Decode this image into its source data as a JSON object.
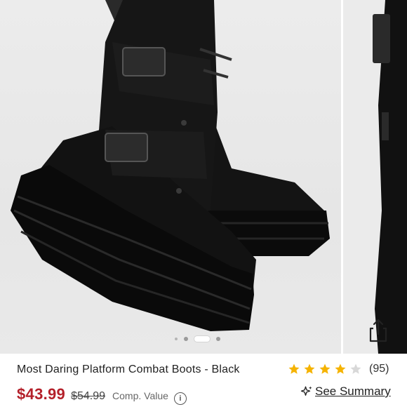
{
  "product": {
    "title": "Most Daring Platform Combat Boots - Black",
    "price": "$43.99",
    "compare_price": "$54.99",
    "compare_label": "Comp. Value",
    "info_icon": "i"
  },
  "rating": {
    "stars": 4,
    "max": 5,
    "count_label": "(95)",
    "star_color": "#f5b301",
    "empty_color": "#d8d8d8"
  },
  "gallery": {
    "active_index": 2,
    "dot_count": 4
  },
  "summary": {
    "label": "See Summary",
    "icon": "sparkle-icon"
  },
  "colors": {
    "price": "#b4202a"
  }
}
